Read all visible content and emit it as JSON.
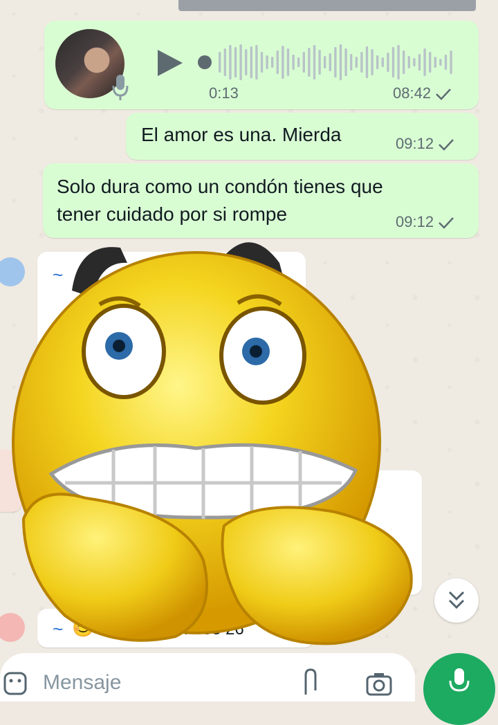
{
  "voice_message": {
    "duration": "0:13",
    "time": "08:42"
  },
  "messages": [
    {
      "text": "El amor es  una. Mierda",
      "time": "09:12"
    },
    {
      "line1": "Solo dura como un condón tienes que",
      "line2": "tener cuidado por si rompe",
      "time": "09:12"
    }
  ],
  "partial_message": {
    "sender_prefix": "~",
    "phone_fragment": "34 633 26"
  },
  "sticker": {
    "name": "nervous-emoji-sticker"
  },
  "composer": {
    "placeholder": "Mensaje"
  },
  "colors": {
    "outgoing_bubble": "#d9fdd3",
    "background": "#efeae2",
    "fab": "#1daa61",
    "meta_text": "#5d6b71"
  }
}
